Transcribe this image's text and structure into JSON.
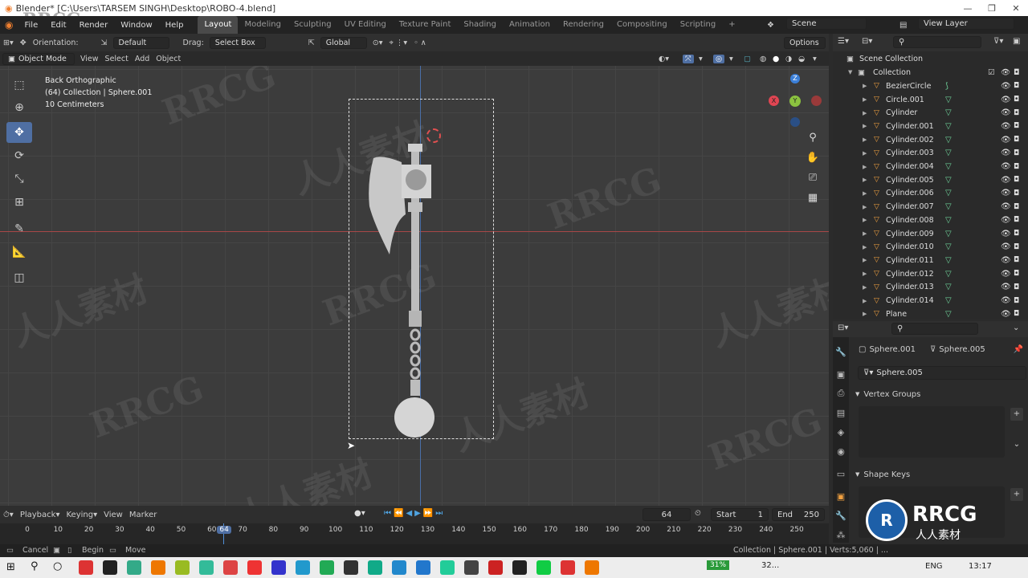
{
  "titlebar": {
    "title": "Blender* [C:\\Users\\TARSEM SINGH\\Desktop\\ROBO-4.blend]",
    "watermark": "RRCG"
  },
  "menus": [
    "File",
    "Edit",
    "Render",
    "Window",
    "Help"
  ],
  "workspaces": [
    "Layout",
    "Modeling",
    "Sculpting",
    "UV Editing",
    "Texture Paint",
    "Shading",
    "Animation",
    "Rendering",
    "Compositing",
    "Scripting"
  ],
  "scene": {
    "label": "Scene",
    "view_layer": "View Layer"
  },
  "header": {
    "orientation_label": "Orientation:",
    "orientation_value": "Default",
    "drag_label": "Drag:",
    "drag_value": "Select Box",
    "transform": "Global",
    "options": "Options"
  },
  "header2": {
    "mode": "Object Mode",
    "view": "View",
    "select": "Select",
    "add": "Add",
    "object": "Object"
  },
  "viewport_info": {
    "line1": "Back Orthographic",
    "line2": "(64) Collection | Sphere.001",
    "line3": "10 Centimeters"
  },
  "gizmo": {
    "z": "Z",
    "y": "Y",
    "x": "X"
  },
  "outliner": {
    "root": "Scene Collection",
    "collection": "Collection",
    "items": [
      "BezierCircle",
      "Circle.001",
      "Cylinder",
      "Cylinder.001",
      "Cylinder.002",
      "Cylinder.003",
      "Cylinder.004",
      "Cylinder.005",
      "Cylinder.006",
      "Cylinder.007",
      "Cylinder.008",
      "Cylinder.009",
      "Cylinder.010",
      "Cylinder.011",
      "Cylinder.012",
      "Cylinder.013",
      "Cylinder.014",
      "Plane"
    ]
  },
  "properties": {
    "object": "Sphere.001",
    "mesh": "Sphere.005",
    "data_name": "Sphere.005",
    "vertex_groups": "Vertex Groups",
    "shape_keys": "Shape Keys"
  },
  "timeline": {
    "playback": "Playback",
    "keying": "Keying",
    "view": "View",
    "marker": "Marker",
    "current_frame": "64",
    "start_label": "Start",
    "start": "1",
    "end_label": "End",
    "end": "250",
    "ticks": [
      "0",
      "10",
      "20",
      "30",
      "40",
      "50",
      "60",
      "64",
      "70",
      "80",
      "90",
      "100",
      "110",
      "120",
      "130",
      "140",
      "150",
      "160",
      "170",
      "180",
      "190",
      "200",
      "210",
      "220",
      "230",
      "240",
      "250"
    ]
  },
  "status": {
    "cancel": "Cancel",
    "begin": "Begin",
    "move": "Move",
    "stats": "Collection | Sphere.001 | Verts:5,060 | ..."
  },
  "taskbar": {
    "battery": "31%",
    "weather": "32...",
    "lang": "ENG",
    "time": "13:17"
  },
  "watermarks": [
    "RRCG",
    "人人素材"
  ],
  "colors": {
    "accent": "#4f6fa3",
    "orange": "#f0a040",
    "mesh_green": "#6fd39b",
    "x_axis": "#e04552",
    "y_axis": "#8bc23f",
    "z_axis": "#3b7fd8"
  }
}
